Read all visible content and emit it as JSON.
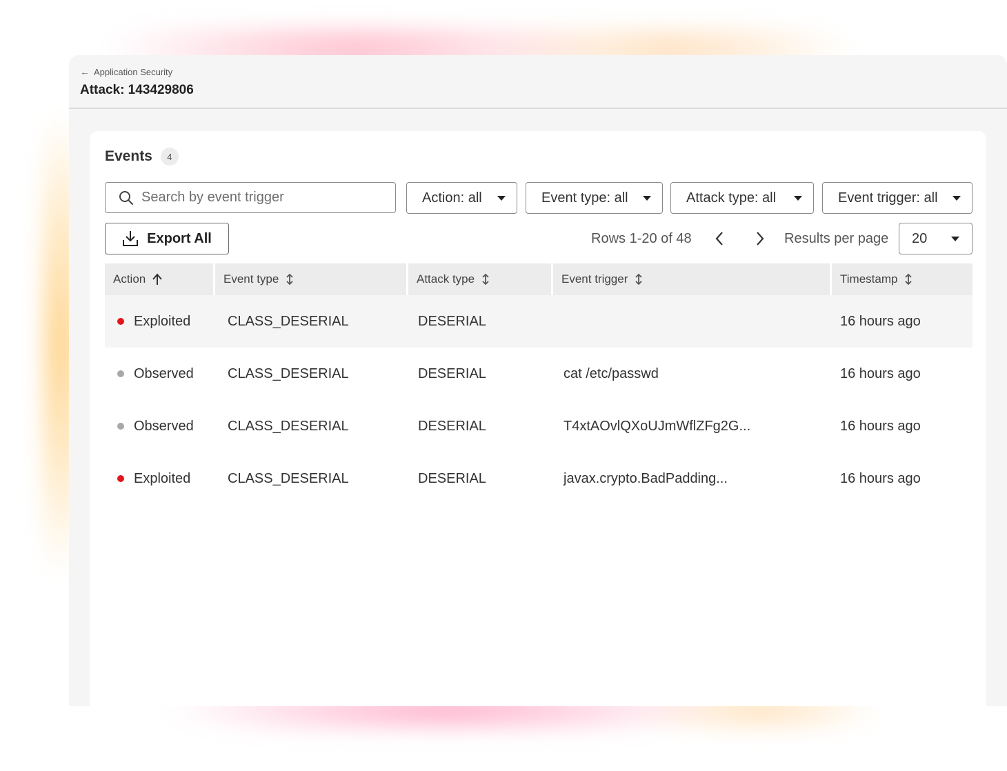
{
  "header": {
    "breadcrumb": "Application Security",
    "title": "Attack: 143429806"
  },
  "events": {
    "heading": "Events",
    "count": "4",
    "search_placeholder": "Search by event trigger",
    "filters": [
      {
        "label": "Action: all"
      },
      {
        "label": "Event type: all"
      },
      {
        "label": "Attack type: all"
      },
      {
        "label": "Event trigger: all"
      }
    ],
    "export_label": "Export All",
    "pagination": {
      "rows_text": "Rows 1-20 of 48",
      "results_per_page_label": "Results per page",
      "results_per_page_value": "20"
    },
    "columns": [
      "Action",
      "Event type",
      "Attack type",
      "Event trigger",
      "Timestamp"
    ],
    "rows": [
      {
        "action": "Exploited",
        "status_color": "#e0161b",
        "event_type": "CLASS_DESERIAL",
        "attack_type": "DESERIAL",
        "event_trigger": "",
        "timestamp": "16 hours ago"
      },
      {
        "action": "Observed",
        "status_color": "#a8a8a8",
        "event_type": "CLASS_DESERIAL",
        "attack_type": "DESERIAL",
        "event_trigger": "cat /etc/passwd",
        "timestamp": "16 hours ago"
      },
      {
        "action": "Observed",
        "status_color": "#a8a8a8",
        "event_type": "CLASS_DESERIAL",
        "attack_type": "DESERIAL",
        "event_trigger": "T4xtAOvlQXoUJmWflZFg2G...",
        "timestamp": "16 hours ago"
      },
      {
        "action": "Exploited",
        "status_color": "#e0161b",
        "event_type": "CLASS_DESERIAL",
        "attack_type": "DESERIAL",
        "event_trigger": "javax.crypto.BadPadding...",
        "timestamp": "16 hours ago"
      }
    ]
  }
}
